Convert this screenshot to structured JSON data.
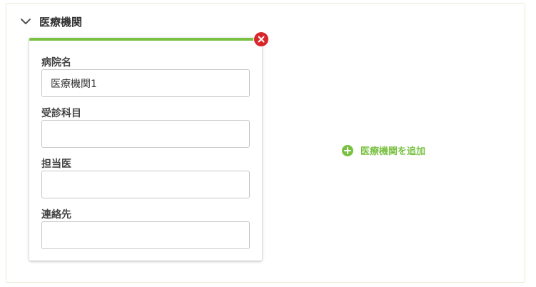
{
  "section": {
    "title": "医療機関",
    "collapse_icon": "chevron-down-icon"
  },
  "card": {
    "accent_color": "#7ac143",
    "remove_icon": "close-circle-icon",
    "remove_color": "#d9262b",
    "fields": [
      {
        "label": "病院名",
        "value": "医療機関1",
        "placeholder": ""
      },
      {
        "label": "受診科目",
        "value": "",
        "placeholder": ""
      },
      {
        "label": "担当医",
        "value": "",
        "placeholder": ""
      },
      {
        "label": "連絡先",
        "value": "",
        "placeholder": ""
      }
    ]
  },
  "add_action": {
    "label": "医療機関を追加",
    "icon": "plus-circle-icon",
    "color": "#7ac143"
  }
}
